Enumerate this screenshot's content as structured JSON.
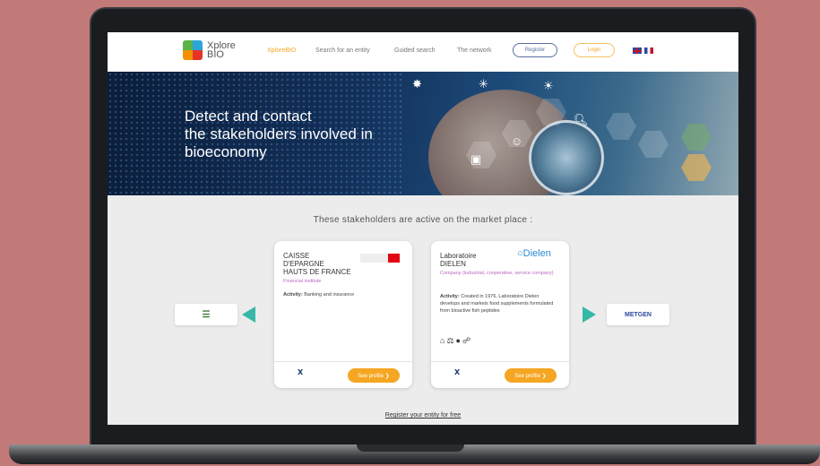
{
  "nav": {
    "logo_line1": "Xplore",
    "logo_line2": "BIO",
    "links": [
      "XploreBIO",
      "Search for an entity",
      "Guided search",
      "The network"
    ],
    "register": "Register",
    "login": "Login"
  },
  "hero": {
    "title_line1": "Detect and contact",
    "title_line2": "the stakeholders involved in",
    "title_line3": "bioeconomy"
  },
  "section_title": "These stakeholders are active on the market place :",
  "cards": [
    {
      "name_line1": "CAISSE",
      "name_line2": "D'EPARGNE",
      "name_line3": "HAUTS DE FRANCE",
      "type": "Financial institute",
      "activity_label": "Activity:",
      "activity": "Banking and insurance",
      "profile_button": "See profile ❯"
    },
    {
      "name_line1": "Laboratoire",
      "name_line2": "DIELEN",
      "type": "Company (industrial, cooperative, service company)",
      "activity_label": "Activity:",
      "activity": "Created in 1976, Laboratoire Dielen develops and markets food supplements formulated from bioactive fish peptides",
      "logo_text": "Dielen",
      "profile_button": "See profile ❯"
    }
  ],
  "side_right_logo": "METGEN",
  "register_link": "Register your entity for free",
  "colors": {
    "accent": "#f5a623",
    "teal_arrow": "#35b9a6",
    "background": "#c27a79"
  }
}
